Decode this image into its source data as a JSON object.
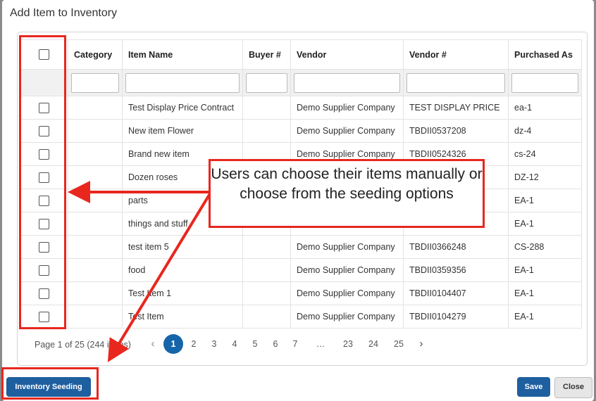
{
  "dialog": {
    "title": "Add Item to Inventory"
  },
  "table": {
    "columns": [
      "",
      "Category",
      "Item Name",
      "Buyer #",
      "Vendor",
      "Vendor #",
      "Purchased As"
    ],
    "rows": [
      {
        "category": "",
        "item_name": "Test Display Price Contract",
        "buyer": "",
        "vendor": "Demo Supplier Company",
        "vendor_no": "TEST DISPLAY PRICE",
        "purchased_as": "ea-1"
      },
      {
        "category": "",
        "item_name": "New item Flower",
        "buyer": "",
        "vendor": "Demo Supplier Company",
        "vendor_no": "TBDII0537208",
        "purchased_as": "dz-4"
      },
      {
        "category": "",
        "item_name": "Brand new item",
        "buyer": "",
        "vendor": "Demo Supplier Company",
        "vendor_no": "TBDII0524326",
        "purchased_as": "cs-24"
      },
      {
        "category": "",
        "item_name": "Dozen roses",
        "buyer": "",
        "vendor": "",
        "vendor_no": "",
        "purchased_as": "DZ-12"
      },
      {
        "category": "",
        "item_name": "parts",
        "buyer": "",
        "vendor": "",
        "vendor_no": "",
        "purchased_as": "EA-1"
      },
      {
        "category": "",
        "item_name": "things and stuff",
        "buyer": "",
        "vendor": "",
        "vendor_no": "",
        "purchased_as": "EA-1"
      },
      {
        "category": "",
        "item_name": "test item 5",
        "buyer": "",
        "vendor": "Demo Supplier Company",
        "vendor_no": "TBDII0366248",
        "purchased_as": "CS-288"
      },
      {
        "category": "",
        "item_name": "food",
        "buyer": "",
        "vendor": "Demo Supplier Company",
        "vendor_no": "TBDII0359356",
        "purchased_as": "EA-1"
      },
      {
        "category": "",
        "item_name": "Test Item 1",
        "buyer": "",
        "vendor": "Demo Supplier Company",
        "vendor_no": "TBDII0104407",
        "purchased_as": "EA-1"
      },
      {
        "category": "",
        "item_name": "Test Item",
        "buyer": "",
        "vendor": "Demo Supplier Company",
        "vendor_no": "TBDII0104279",
        "purchased_as": "EA-1"
      }
    ]
  },
  "pager": {
    "info": "Page 1 of 25 (244 items)",
    "pages": [
      "1",
      "2",
      "3",
      "4",
      "5",
      "6",
      "7",
      "…",
      "23",
      "24",
      "25"
    ],
    "current_page": "1",
    "prev_icon": "‹",
    "next_icon": "›"
  },
  "buttons": {
    "seeding": "Inventory Seeding",
    "save": "Save",
    "close": "Close"
  },
  "annotation": {
    "callout_text": "Users can choose their items manually or choose from the seeding options",
    "color": "#e8271e"
  },
  "colors": {
    "primary": "#1e5fa0",
    "active_page": "#1565a8"
  }
}
